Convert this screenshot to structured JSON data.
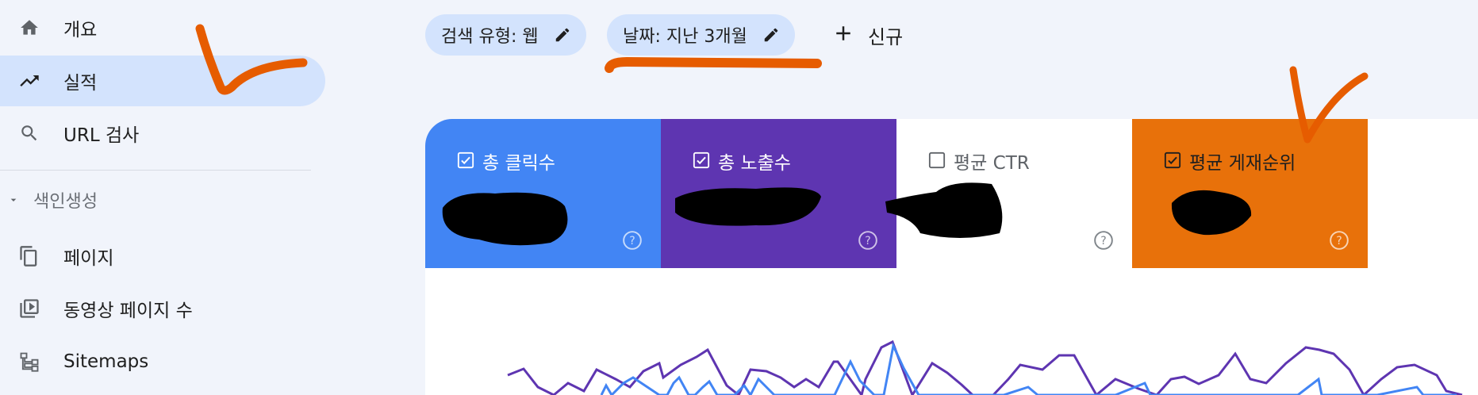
{
  "sidebar": {
    "items": [
      {
        "label": "개요",
        "icon": "home-icon"
      },
      {
        "label": "실적",
        "icon": "trending-up-icon",
        "active": true
      },
      {
        "label": "URL 검사",
        "icon": "search-icon"
      }
    ],
    "section": {
      "label": "색인생성",
      "icon": "caret-down-icon"
    },
    "section_items": [
      {
        "label": "페이지",
        "icon": "pages-icon"
      },
      {
        "label": "동영상 페이지 수",
        "icon": "video-pages-icon"
      },
      {
        "label": "Sitemaps",
        "icon": "sitemap-icon"
      }
    ]
  },
  "filters": {
    "chips": [
      {
        "label": "검색 유형: 웹",
        "icon": "edit-icon"
      },
      {
        "label": "날짜: 지난 3개월",
        "icon": "edit-icon"
      }
    ],
    "new_label": "신규"
  },
  "metrics": [
    {
      "label": "총 클릭수",
      "checked": true,
      "color": "#4285f4",
      "value": "redacted"
    },
    {
      "label": "총 노출수",
      "checked": true,
      "color": "#5e35b1",
      "value": "redacted"
    },
    {
      "label": "평균 CTR",
      "checked": false,
      "color": "#ffffff",
      "value": "redacted"
    },
    {
      "label": "평균 게재순위",
      "checked": true,
      "color": "#e8710a",
      "value": "redacted"
    }
  ],
  "colors": {
    "accent": "#d3e3fd",
    "clicks": "#4285f4",
    "impressions": "#5e35b1",
    "position": "#e8710a",
    "annotation": "#e65c00"
  }
}
